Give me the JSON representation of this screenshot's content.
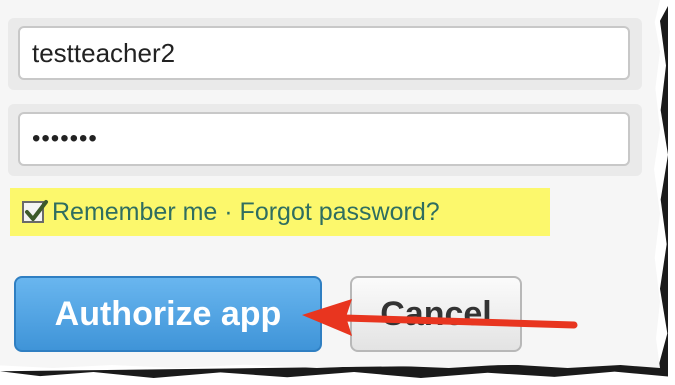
{
  "login_form": {
    "username_value": "testteacher2",
    "password_value": "•••••••",
    "remember_label": "Remember me · ",
    "forgot_label": "Forgot password?"
  },
  "actions": {
    "authorize_label": "Authorize app",
    "cancel_label": "Cancel"
  },
  "colors": {
    "highlight": "#fcf86c",
    "link": "#2f6e60",
    "primary_button": "#4a9fe0",
    "annotation_arrow": "#e8351f"
  },
  "annotation": {
    "icon": "red-arrow-icon"
  }
}
